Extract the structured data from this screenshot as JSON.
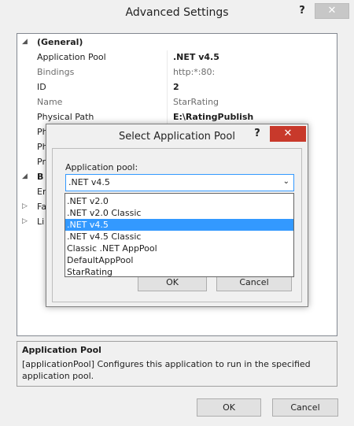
{
  "window": {
    "title": "Advanced Settings",
    "help": "?",
    "close": "✕",
    "ok_label": "OK",
    "cancel_label": "Cancel"
  },
  "grid": {
    "rows": [
      {
        "expander": "◢",
        "key": "(General)",
        "value": "",
        "key_bold": true,
        "gray": false
      },
      {
        "expander": "",
        "key": "Application Pool",
        "value": ".NET v4.5",
        "value_bold": true,
        "gray": false
      },
      {
        "expander": "",
        "key": "Bindings",
        "value": "http:*:80:",
        "gray": true
      },
      {
        "expander": "",
        "key": "ID",
        "value": "2",
        "value_bold": true,
        "gray": false
      },
      {
        "expander": "",
        "key": "Name",
        "value": "StarRating",
        "gray": true
      },
      {
        "expander": "",
        "key": "Physical Path",
        "value": "E:\\RatingPublish",
        "value_bold": true,
        "gray": false
      },
      {
        "expander": "",
        "key": "Ph",
        "value": "",
        "gray": false
      },
      {
        "expander": "",
        "key": "Ph",
        "value": "",
        "gray": false
      },
      {
        "expander": "",
        "key": "Pr",
        "value": "",
        "gray": false
      },
      {
        "expander": "◢",
        "key": "B",
        "value": "",
        "key_bold": true,
        "gray": false
      },
      {
        "expander": "",
        "key": "Er",
        "value": "",
        "gray": false
      },
      {
        "expander": "▷",
        "key": "Fa",
        "value": "",
        "gray": false
      },
      {
        "expander": "▷",
        "key": "Li",
        "value": "",
        "gray": false
      }
    ]
  },
  "description": {
    "heading": "Application Pool",
    "body": "[applicationPool] Configures this application to run in the specified application pool."
  },
  "dialog": {
    "title": "Select Application Pool",
    "help": "?",
    "close": "✕",
    "label": "Application pool:",
    "selected": ".NET v4.5",
    "arrow": "⌄",
    "options": [
      ".NET v2.0",
      ".NET v2.0 Classic",
      ".NET v4.5",
      ".NET v4.5 Classic",
      "Classic .NET AppPool",
      "DefaultAppPool",
      "StarRating"
    ],
    "selected_index": 2,
    "ok_label": "OK",
    "cancel_label": "Cancel"
  },
  "colors": {
    "selection": "#3399ff",
    "close_red": "#c8392b"
  }
}
